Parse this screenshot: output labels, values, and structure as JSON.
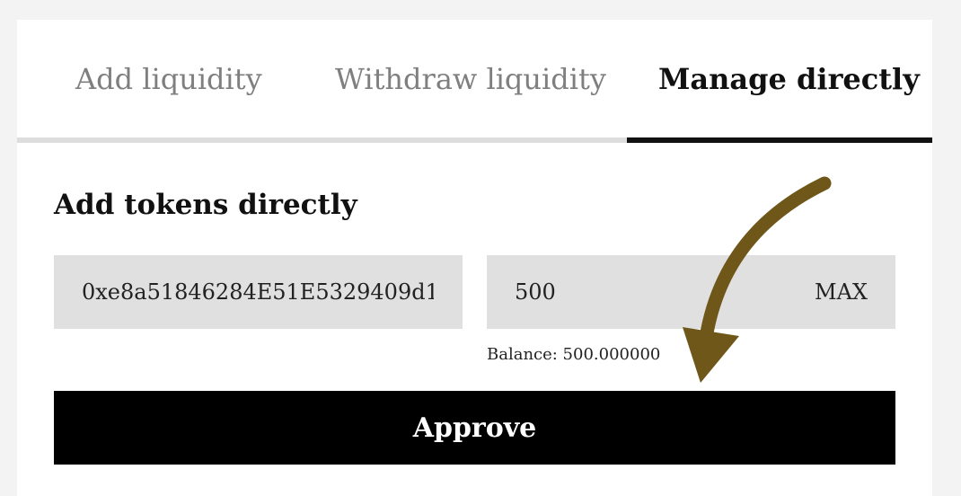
{
  "tabs": [
    {
      "label": "Add liquidity",
      "active": false
    },
    {
      "label": "Withdraw liquidity",
      "active": false
    },
    {
      "label": "Manage directly",
      "active": true
    }
  ],
  "section": {
    "title": "Add tokens directly"
  },
  "token_address": {
    "value": "0xe8a51846284E51E5329409d1"
  },
  "amount": {
    "value": "500",
    "max_label": "MAX"
  },
  "balance": {
    "text": "Balance: 500.000000"
  },
  "approve": {
    "label": "Approve"
  },
  "colors": {
    "accent_arrow": "#6f5719",
    "active_underline": "#111111",
    "inactive_underline": "#dddddd",
    "field_background": "#e0e0e0",
    "button_background": "#000000"
  },
  "icons": {
    "annotation": "curved-arrow-icon"
  }
}
